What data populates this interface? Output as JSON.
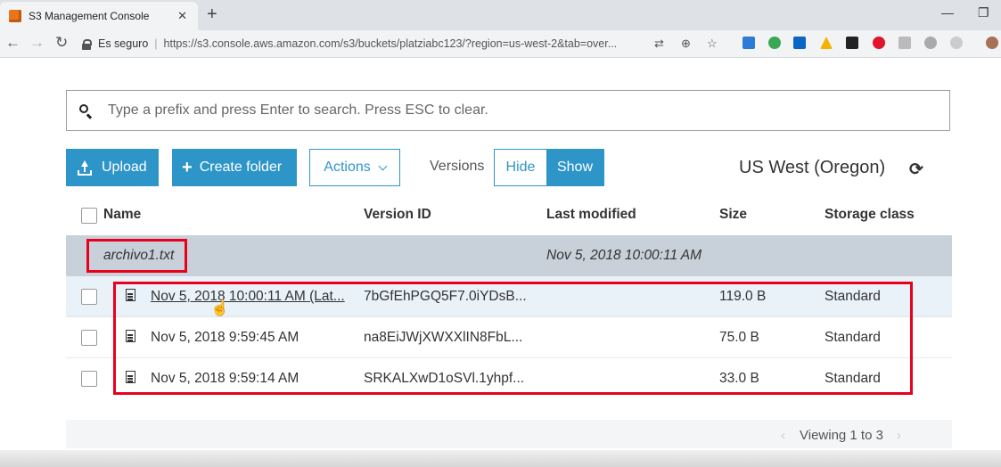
{
  "browser": {
    "tab_title": "S3 Management Console",
    "tab_close": "✕",
    "new_tab": "+",
    "secure_label": "Es seguro",
    "url": "https://s3.console.aws.amazon.com/s3/buckets/platziabc123/?region=us-west-2&tab=over...",
    "minimize": "—",
    "restore": "❐"
  },
  "search": {
    "placeholder": "Type a prefix and press Enter to search. Press ESC to clear."
  },
  "toolbar": {
    "upload_label": "Upload",
    "create_folder_label": "Create folder",
    "actions_label": "Actions",
    "versions_label": "Versions",
    "hide_label": "Hide",
    "show_label": "Show",
    "region": "US West (Oregon)"
  },
  "table": {
    "headers": {
      "name": "Name",
      "version_id": "Version ID",
      "last_modified": "Last modified",
      "size": "Size",
      "storage_class": "Storage class"
    },
    "object": {
      "name": "archivo1.txt",
      "last_modified": "Nov 5, 2018 10:00:11 AM"
    },
    "versions": [
      {
        "name": "Nov 5, 2018 10:00:11 AM (Lat...",
        "version_id": "7bGfEhPGQ5F7.0iYDsB...",
        "size": "119.0 B",
        "storage_class": "Standard"
      },
      {
        "name": "Nov 5, 2018 9:59:45 AM",
        "version_id": "na8EiJWjXWXXlIN8FbL...",
        "size": "75.0 B",
        "storage_class": "Standard"
      },
      {
        "name": "Nov 5, 2018 9:59:14 AM",
        "version_id": "SRKALXwD1oSVl.1yhpf...",
        "size": "33.0 B",
        "storage_class": "Standard"
      }
    ]
  },
  "pagination": {
    "viewing": "Viewing 1 to 3",
    "prev": "‹",
    "next": "›"
  }
}
